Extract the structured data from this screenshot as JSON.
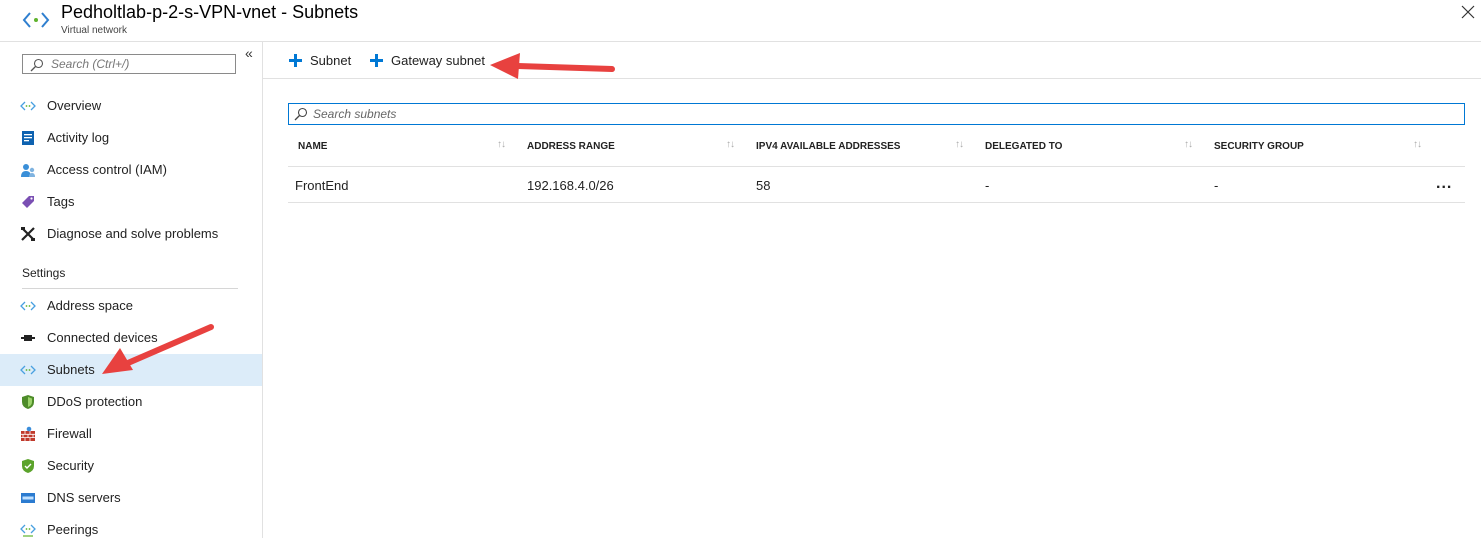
{
  "header": {
    "title": "Pedholtlab-p-2-s-VPN-vnet - Subnets",
    "subtitle": "Virtual network"
  },
  "sidebar": {
    "search_placeholder": "Search (Ctrl+/)",
    "items": [
      {
        "label": "Overview",
        "icon": "vnet-icon"
      },
      {
        "label": "Activity log",
        "icon": "activity-log-icon"
      },
      {
        "label": "Access control (IAM)",
        "icon": "iam-icon"
      },
      {
        "label": "Tags",
        "icon": "tag-icon"
      },
      {
        "label": "Diagnose and solve problems",
        "icon": "wrench-icon"
      }
    ],
    "settings_label": "Settings",
    "settings_items": [
      {
        "label": "Address space",
        "icon": "vnet-icon"
      },
      {
        "label": "Connected devices",
        "icon": "plug-icon"
      },
      {
        "label": "Subnets",
        "icon": "vnet-icon",
        "active": true
      },
      {
        "label": "DDoS protection",
        "icon": "shield-icon"
      },
      {
        "label": "Firewall",
        "icon": "firewall-icon"
      },
      {
        "label": "Security",
        "icon": "security-shield-icon"
      },
      {
        "label": "DNS servers",
        "icon": "dns-icon"
      },
      {
        "label": "Peerings",
        "icon": "peering-icon"
      }
    ]
  },
  "toolbar": {
    "subnet_label": "Subnet",
    "gateway_subnet_label": "Gateway subnet"
  },
  "subnets": {
    "search_placeholder": "Search subnets",
    "columns": [
      "NAME",
      "ADDRESS RANGE",
      "IPV4 AVAILABLE ADDRESSES",
      "DELEGATED TO",
      "SECURITY GROUP"
    ],
    "rows": [
      {
        "name": "FrontEnd",
        "address_range": "192.168.4.0/26",
        "available": "58",
        "delegated_to": "-",
        "security_group": "-"
      }
    ],
    "more": "..."
  },
  "colors": {
    "accent": "#0078d4",
    "active_bg": "#dcecf9",
    "annotation_arrow": "#e8413f"
  }
}
